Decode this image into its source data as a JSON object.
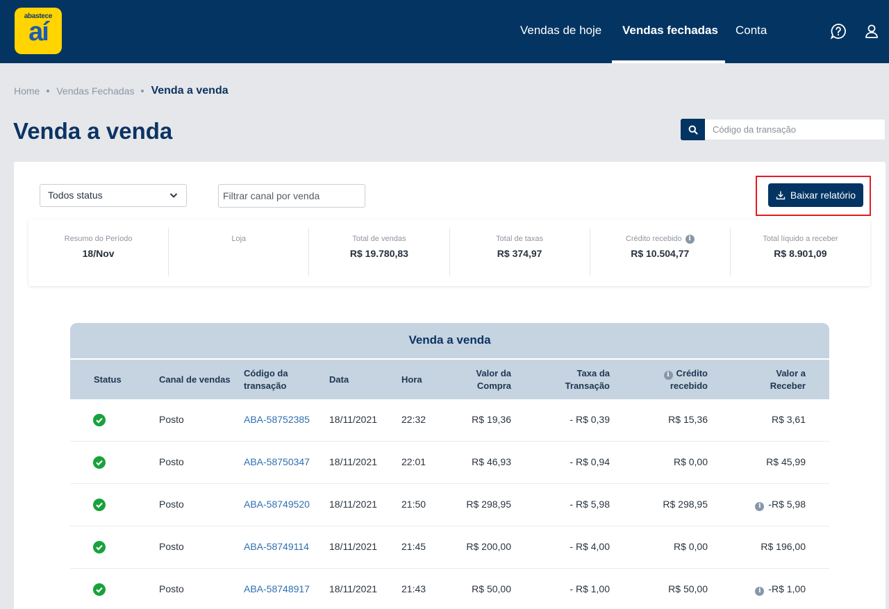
{
  "header": {
    "logo_small": "abastece",
    "logo_big": "aí",
    "nav": [
      {
        "label": "Vendas de hoje",
        "active": false
      },
      {
        "label": "Vendas fechadas",
        "active": true
      },
      {
        "label": "Conta",
        "active": false
      }
    ]
  },
  "breadcrumb": {
    "items": [
      "Home",
      "Vendas Fechadas"
    ],
    "current": "Venda a venda"
  },
  "page_title": "Venda a venda",
  "search": {
    "placeholder": "Código da transação"
  },
  "filters": {
    "status_selected": "Todos status",
    "channel_placeholder": "Filtrar canal por venda",
    "download_label": "Baixar relatório"
  },
  "summary": [
    {
      "label": "Resumo do Período",
      "value": "18/Nov"
    },
    {
      "label": "Loja",
      "value": ""
    },
    {
      "label": "Total de vendas",
      "value": "R$ 19.780,83"
    },
    {
      "label": "Total de taxas",
      "value": "R$ 374,97"
    },
    {
      "label": "Crédito recebido",
      "value": "R$ 10.504,77"
    },
    {
      "label": "Total líquido a receber",
      "value": "R$ 8.901,09"
    }
  ],
  "table": {
    "title": "Venda a venda",
    "columns": {
      "status": "Status",
      "canal": "Canal de vendas",
      "codigo_1": "Código da",
      "codigo_2": "transação",
      "data": "Data",
      "hora": "Hora",
      "valor_1": "Valor da",
      "valor_2": "Compra",
      "taxa_1": "Taxa da",
      "taxa_2": "Transação",
      "credito_1": "Crédito",
      "credito_2": "recebido",
      "receber_1": "Valor a",
      "receber_2": "Receber"
    },
    "rows": [
      {
        "canal": "Posto",
        "codigo": "ABA-58752385",
        "data": "18/11/2021",
        "hora": "22:32",
        "valor": "R$ 19,36",
        "taxa": "- R$ 0,39",
        "credito": "R$ 15,36",
        "receber": "R$ 3,61"
      },
      {
        "canal": "Posto",
        "codigo": "ABA-58750347",
        "data": "18/11/2021",
        "hora": "22:01",
        "valor": "R$ 46,93",
        "taxa": "- R$ 0,94",
        "credito": "R$ 0,00",
        "receber": "R$ 45,99"
      },
      {
        "canal": "Posto",
        "codigo": "ABA-58749520",
        "data": "18/11/2021",
        "hora": "21:50",
        "valor": "R$ 298,95",
        "taxa": "- R$ 5,98",
        "credito": "R$ 298,95",
        "receber": "-R$ 5,98"
      },
      {
        "canal": "Posto",
        "codigo": "ABA-58749114",
        "data": "18/11/2021",
        "hora": "21:45",
        "valor": "R$ 200,00",
        "taxa": "- R$ 4,00",
        "credito": "R$ 0,00",
        "receber": "R$ 196,00"
      },
      {
        "canal": "Posto",
        "codigo": "ABA-58748917",
        "data": "18/11/2021",
        "hora": "21:43",
        "valor": "R$ 50,00",
        "taxa": "- R$ 1,00",
        "credito": "R$ 50,00",
        "receber": "-R$ 1,00"
      }
    ]
  },
  "colors": {
    "header_bg": "#033462",
    "logo_bg": "#ffd400",
    "table_header_bg": "#c5d4e0",
    "status_ok": "#18a23c",
    "link": "#2e6fb0",
    "highlight": "#e11b22"
  },
  "icons": [
    "search-icon",
    "help-icon",
    "user-icon",
    "chevron-down-icon",
    "download-icon",
    "info-icon",
    "check-circle-icon"
  ]
}
